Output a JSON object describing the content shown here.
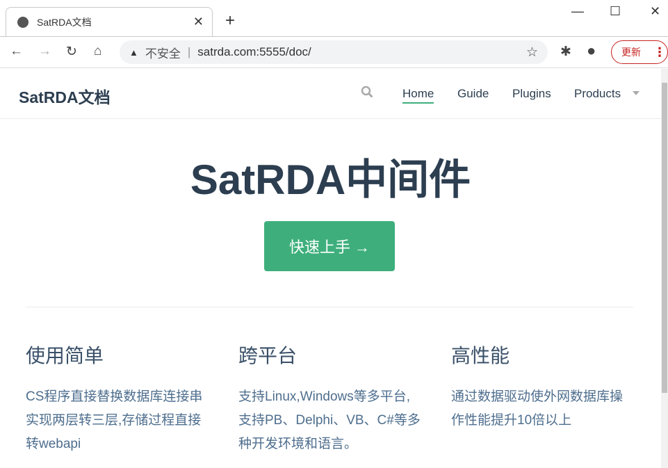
{
  "browser": {
    "tab_title": "SatRDA文档",
    "url_warning": "不安全",
    "url": "satrda.com:5555/doc/",
    "update_label": "更新",
    "icons": [
      "globe-icon",
      "close-icon",
      "plus-icon",
      "minimize-icon",
      "maximize-icon",
      "window-close-icon",
      "back-icon",
      "forward-icon",
      "reload-icon",
      "home-icon",
      "warning-icon",
      "star-icon",
      "extensions-icon",
      "profile-icon",
      "menu-icon"
    ]
  },
  "nav": {
    "brand": "SatRDA文档",
    "links": [
      {
        "label": "Home"
      },
      {
        "label": "Guide"
      },
      {
        "label": "Plugins"
      },
      {
        "label": "Products"
      }
    ],
    "accent": "#3eaf7c"
  },
  "hero": {
    "title_latin": "SatRDA",
    "title_cjk": "中间件",
    "cta": "快速上手 →"
  },
  "features": [
    {
      "title": "使用简单",
      "desc": "CS程序直接替换数据库连接串实现两层转三层,存储过程直接转webapi"
    },
    {
      "title": "跨平台",
      "desc": "支持Linux,Windows等多平台,支持PB、Delphi、VB、C#等多种开发环境和语言。"
    },
    {
      "title": "高性能",
      "desc": "通过数据驱动使外网数据库操作性能提升10倍以上"
    }
  ]
}
